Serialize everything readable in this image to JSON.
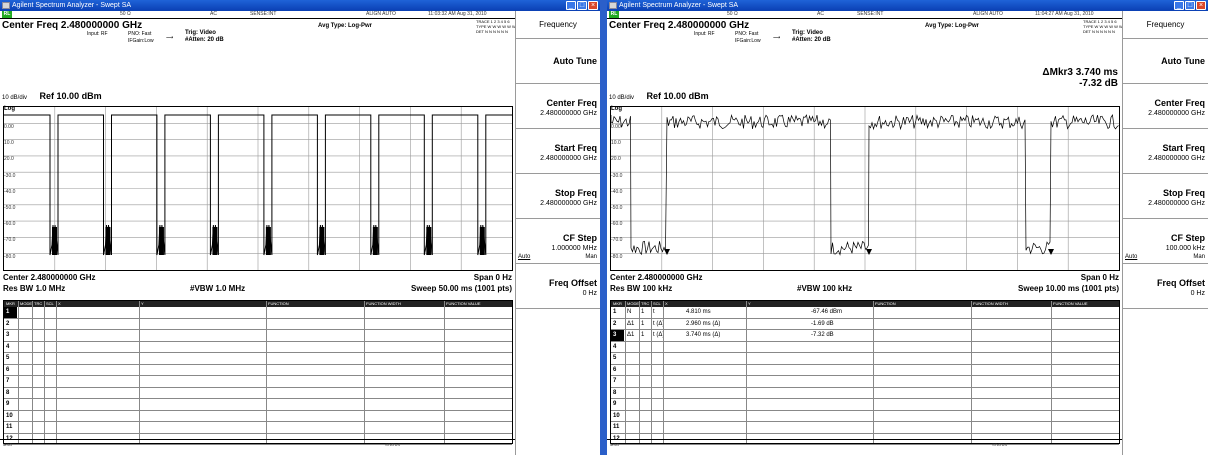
{
  "windows": [
    {
      "title": "Agilent Spectrum Analyzer - Swept SA",
      "status_bar": {
        "lxi": "RL",
        "range": "50 Ω",
        "ac": "AC",
        "sense": "SENSE:INT",
        "align": "ALIGN AUTO",
        "time": "11:03:32 AM Aug 31, 2010"
      },
      "center_freq_label": "Center Freq  2.480000000 GHz",
      "input": "Input: RF",
      "pno": "PNO: Fast",
      "ifgain": "IFGain:Low",
      "trig": "Trig: Video",
      "atten": "#Atten: 20 dB",
      "avg_type": "Avg Type: Log-Pwr",
      "trace_info": {
        "trace": "TRACE 1 2 3 4 5 6",
        "type": "TYPE W W W W W W",
        "det": "DET N N N N N N"
      },
      "marker_readout": {
        "label": "",
        "value": ""
      },
      "scale": "10 dB/div",
      "ref": "Ref 10.00 dBm",
      "log": "Log",
      "y_labels": [
        "0.00",
        "10.0",
        "20.0",
        "-30.0",
        "-40.0",
        "-50.0",
        "-60.0",
        "-70.0",
        "-80.0"
      ],
      "trace_note": "TRIG LVL",
      "center": "Center 2.480000000 GHz",
      "span": "Span 0 Hz",
      "res_bw": "Res BW 1.0 MHz",
      "vbw": "#VBW 1.0 MHz",
      "sweep": "Sweep  50.00 ms (1001 pts)",
      "table_headers": [
        "MKR",
        "MODE",
        "TRC",
        "SCL",
        "X",
        "Y",
        "FUNCTION",
        "FUNCTION WIDTH",
        "FUNCTION VALUE"
      ],
      "table_rows": [
        {
          "n": "1",
          "mode": "",
          "trc": "",
          "scl": "",
          "x": "",
          "y": "",
          "selected": true
        },
        {
          "n": "2",
          "mode": "",
          "trc": "",
          "scl": "",
          "x": "",
          "y": ""
        },
        {
          "n": "3",
          "mode": "",
          "trc": "",
          "scl": "",
          "x": "",
          "y": ""
        },
        {
          "n": "4",
          "mode": "",
          "trc": "",
          "scl": "",
          "x": "",
          "y": ""
        },
        {
          "n": "5",
          "mode": "",
          "trc": "",
          "scl": "",
          "x": "",
          "y": ""
        },
        {
          "n": "6",
          "mode": "",
          "trc": "",
          "scl": "",
          "x": "",
          "y": ""
        },
        {
          "n": "7",
          "mode": "",
          "trc": "",
          "scl": "",
          "x": "",
          "y": ""
        },
        {
          "n": "8",
          "mode": "",
          "trc": "",
          "scl": "",
          "x": "",
          "y": ""
        },
        {
          "n": "9",
          "mode": "",
          "trc": "",
          "scl": "",
          "x": "",
          "y": ""
        },
        {
          "n": "10",
          "mode": "",
          "trc": "",
          "scl": "",
          "x": "",
          "y": ""
        },
        {
          "n": "11",
          "mode": "",
          "trc": "",
          "scl": "",
          "x": "",
          "y": ""
        },
        {
          "n": "12",
          "mode": "",
          "trc": "",
          "scl": "",
          "x": "",
          "y": ""
        }
      ],
      "msg": "MSG",
      "status": "STATUS",
      "menu": {
        "title": "Frequency",
        "auto_tune": "Auto Tune",
        "center_freq": {
          "label": "Center Freq",
          "value": "2.480000000 GHz"
        },
        "start_freq": {
          "label": "Start Freq",
          "value": "2.480000000 GHz"
        },
        "stop_freq": {
          "label": "Stop Freq",
          "value": "2.480000000 GHz"
        },
        "cf_step": {
          "label": "CF Step",
          "value": "1.000000 MHz",
          "auto": "Auto",
          "man": "Man"
        },
        "freq_offset": {
          "label": "Freq Offset",
          "value": "0 Hz"
        }
      }
    },
    {
      "title": "Agilent Spectrum Analyzer - Swept SA",
      "status_bar": {
        "lxi": "RL",
        "range": "50 Ω",
        "ac": "AC",
        "sense": "SENSE:INT",
        "align": "ALIGN AUTO",
        "time": "11:04:27 AM Aug 31, 2010"
      },
      "center_freq_label": "Center Freq  2.480000000 GHz",
      "input": "Input: RF",
      "pno": "PNO: Fast",
      "ifgain": "IFGain:Low",
      "trig": "Trig: Video",
      "atten": "#Atten: 20 dB",
      "avg_type": "Avg Type: Log-Pwr",
      "trace_info": {
        "trace": "TRACE 1 2 3 4 5 6",
        "type": "TYPE W W W W W W",
        "det": "DET N N N N N N"
      },
      "marker_readout": {
        "label": "ΔMkr3 3.740 ms",
        "value": "-7.32 dB"
      },
      "scale": "10 dB/div",
      "ref": "Ref 10.00 dBm",
      "log": "Log",
      "y_labels": [
        "0.00",
        "10.0",
        "20.0",
        "-30.0",
        "-40.0",
        "-50.0",
        "-60.0",
        "-70.0",
        "-80.0"
      ],
      "trace_note": "TRIG LVL",
      "center": "Center 2.480000000 GHz",
      "span": "Span 0 Hz",
      "res_bw": "Res BW 100 kHz",
      "vbw": "#VBW 100 kHz",
      "sweep": "Sweep  10.00 ms (1001 pts)",
      "table_headers": [
        "MKR",
        "MODE",
        "TRC",
        "SCL",
        "X",
        "Y",
        "FUNCTION",
        "FUNCTION WIDTH",
        "FUNCTION VALUE"
      ],
      "table_rows": [
        {
          "n": "1",
          "mode": "N",
          "trc": "1",
          "scl": "t",
          "x": "4.810 ms",
          "y": "-67.46 dBm"
        },
        {
          "n": "2",
          "mode": "Δ1",
          "trc": "1",
          "scl": "t  (Δ)",
          "x": "2.960 ms  (Δ)",
          "y": "-1.69 dB"
        },
        {
          "n": "3",
          "mode": "Δ1",
          "trc": "1",
          "scl": "t  (Δ)",
          "x": "3.740 ms  (Δ)",
          "y": "-7.32 dB",
          "selected": true
        },
        {
          "n": "4",
          "mode": "",
          "trc": "",
          "scl": "",
          "x": "",
          "y": ""
        },
        {
          "n": "5",
          "mode": "",
          "trc": "",
          "scl": "",
          "x": "",
          "y": ""
        },
        {
          "n": "6",
          "mode": "",
          "trc": "",
          "scl": "",
          "x": "",
          "y": ""
        },
        {
          "n": "7",
          "mode": "",
          "trc": "",
          "scl": "",
          "x": "",
          "y": ""
        },
        {
          "n": "8",
          "mode": "",
          "trc": "",
          "scl": "",
          "x": "",
          "y": ""
        },
        {
          "n": "9",
          "mode": "",
          "trc": "",
          "scl": "",
          "x": "",
          "y": ""
        },
        {
          "n": "10",
          "mode": "",
          "trc": "",
          "scl": "",
          "x": "",
          "y": ""
        },
        {
          "n": "11",
          "mode": "",
          "trc": "",
          "scl": "",
          "x": "",
          "y": ""
        },
        {
          "n": "12",
          "mode": "",
          "trc": "",
          "scl": "",
          "x": "",
          "y": ""
        }
      ],
      "msg": "MSG",
      "status": "STATUS",
      "menu": {
        "title": "Frequency",
        "auto_tune": "Auto Tune",
        "center_freq": {
          "label": "Center Freq",
          "value": "2.480000000 GHz"
        },
        "start_freq": {
          "label": "Start Freq",
          "value": "2.480000000 GHz"
        },
        "stop_freq": {
          "label": "Stop Freq",
          "value": "2.480000000 GHz"
        },
        "cf_step": {
          "label": "CF Step",
          "value": "100.000 kHz",
          "auto": "Auto",
          "man": "Man"
        },
        "freq_offset": {
          "label": "Freq Offset",
          "value": "0 Hz"
        }
      }
    }
  ],
  "colors": {
    "titlebar": "#0a3fb3",
    "close_button": "#d8472b",
    "trace": "#000000",
    "grid": "#9a9a9a"
  }
}
